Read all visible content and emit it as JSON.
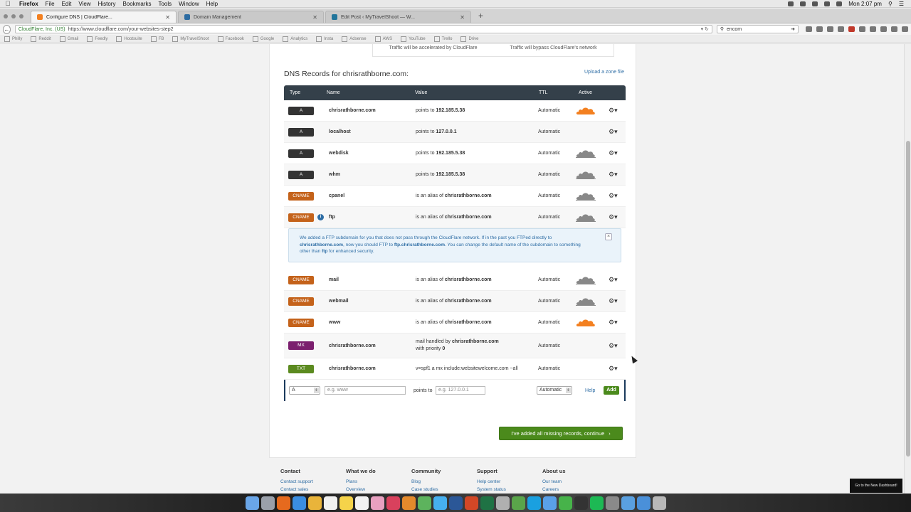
{
  "menubar": {
    "app": "Firefox",
    "items": [
      "File",
      "Edit",
      "View",
      "History",
      "Bookmarks",
      "Tools",
      "Window",
      "Help"
    ],
    "clock": "Mon 2:07 pm"
  },
  "tabs": [
    {
      "title": "Configure DNS | CloudFlare...",
      "active": true
    },
    {
      "title": "Domain Management",
      "active": false
    },
    {
      "title": "Edit Post ‹ MyTravelShoot — W...",
      "active": false
    }
  ],
  "navbar": {
    "site_identity": "CloudFlare, Inc. (US)",
    "url": "https://www.cloudflare.com/your-websites-step2",
    "search_value": "encom"
  },
  "bookmarks": [
    "Philly",
    "Reddit",
    "Gmail",
    "Feedly",
    "Hootsuite",
    "FB",
    "MyTravelShoot",
    "Facebook",
    "Google",
    "Analytics",
    "Insta",
    "Adsense",
    "AWS",
    "YouTube",
    "Trello",
    "Drive"
  ],
  "traffic_strip": {
    "left": "Traffic will be accelerated by CloudFlare",
    "right": "Traffic will bypass CloudFlare's network"
  },
  "dns": {
    "title": "DNS Records for chrisrathborne.com:",
    "upload_link": "Upload a zone file",
    "headers": {
      "type": "Type",
      "name": "Name",
      "value": "Value",
      "ttl": "TTL",
      "active": "Active"
    },
    "records": [
      {
        "type": "A",
        "name": "chrisrathborne.com",
        "value_prefix": "points to ",
        "value_bold": "192.185.5.38",
        "ttl": "Automatic",
        "active": "orange"
      },
      {
        "type": "A",
        "name": "localhost",
        "value_prefix": "points to ",
        "value_bold": "127.0.0.1",
        "ttl": "Automatic",
        "active": "none"
      },
      {
        "type": "A",
        "name": "webdisk",
        "value_prefix": "points to ",
        "value_bold": "192.185.5.38",
        "ttl": "Automatic",
        "active": "grey"
      },
      {
        "type": "A",
        "name": "whm",
        "value_prefix": "points to ",
        "value_bold": "192.185.5.38",
        "ttl": "Automatic",
        "active": "grey"
      },
      {
        "type": "CNAME",
        "name": "cpanel",
        "value_prefix": "is an alias of ",
        "value_bold": "chrisrathborne.com",
        "ttl": "Automatic",
        "active": "grey"
      },
      {
        "type": "CNAME",
        "name": "ftp",
        "value_prefix": "is an alias of ",
        "value_bold": "chrisrathborne.com",
        "ttl": "Automatic",
        "active": "grey",
        "info": true
      },
      {
        "type": "CNAME",
        "name": "mail",
        "value_prefix": "is an alias of ",
        "value_bold": "chrisrathborne.com",
        "ttl": "Automatic",
        "active": "grey"
      },
      {
        "type": "CNAME",
        "name": "webmail",
        "value_prefix": "is an alias of ",
        "value_bold": "chrisrathborne.com",
        "ttl": "Automatic",
        "active": "grey"
      },
      {
        "type": "CNAME",
        "name": "www",
        "value_prefix": "is an alias of ",
        "value_bold": "chrisrathborne.com",
        "ttl": "Automatic",
        "active": "orange"
      },
      {
        "type": "MX",
        "name": "chrisrathborne.com",
        "value_prefix": "mail handled by ",
        "value_bold": "chrisrathborne.com",
        "value_line2_prefix": "with priority ",
        "value_line2_bold": "0",
        "ttl": "Automatic",
        "active": "none"
      },
      {
        "type": "TXT",
        "name": "chrisrathborne.com",
        "value_prefix": "v=spf1 a mx include:websitewelcome.com ~all",
        "value_bold": "",
        "ttl": "Automatic",
        "active": "none"
      }
    ],
    "notice": {
      "t1": "We added a FTP subdomain for you that does not pass through the CloudFlare network. If in the past you FTPed directly to",
      "b1": "chrisrathborne.com",
      "t2": ", now you should FTP to ",
      "b2": "ftp.chrisrathborne.com",
      "t3": ". You can change the default name of the subdomain to something other than ",
      "b3": "ftp",
      "t4": " for enhanced security.",
      "close": "×"
    },
    "add_row": {
      "type_value": "A",
      "name_placeholder": "e.g. www",
      "points_label": "points to",
      "value_placeholder": "e.g. 127.0.0.1",
      "ttl_value": "Automatic",
      "help": "Help",
      "add": "Add"
    },
    "continue_button": "I've added all missing records, continue"
  },
  "footer": [
    {
      "heading": "Contact",
      "links": [
        "Contact support",
        "Contact sales"
      ]
    },
    {
      "heading": "What we do",
      "links": [
        "Plans",
        "Overview"
      ]
    },
    {
      "heading": "Community",
      "links": [
        "Blog",
        "Case studies"
      ]
    },
    {
      "heading": "Support",
      "links": [
        "Help center",
        "System status"
      ]
    },
    {
      "heading": "About us",
      "links": [
        "Our team",
        "Careers"
      ]
    }
  ],
  "dashboard_button": "Go to the New Dashboard!",
  "colors": {
    "cloud_orange": "#f38020",
    "cloud_grey": "#888888",
    "badge_a": "#333333",
    "badge_cname": "#c4621a",
    "badge_mx": "#7b1f6e",
    "badge_txt": "#5b8a1f",
    "button_green": "#4b8a1c",
    "link_blue": "#2f6ea5"
  },
  "dock": [
    "finder",
    "launchpad",
    "firefox",
    "safari",
    "chrome",
    "calendar",
    "notes",
    "reminders",
    "photos",
    "itunes",
    "ibooks",
    "maps",
    "messages",
    "word",
    "powerpoint",
    "excel",
    "preview",
    "evernote",
    "skype",
    "mail",
    "facetime",
    "terminal",
    "spotify",
    "system-prefs",
    "folder",
    "downloads",
    "trash"
  ]
}
